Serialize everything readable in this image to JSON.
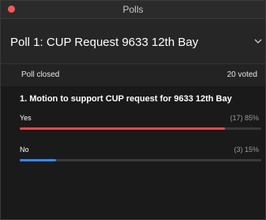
{
  "window": {
    "title": "Polls"
  },
  "poll": {
    "title": "Poll 1: CUP Request 9633 12th Bay",
    "status": "Poll closed",
    "voted": "20 voted",
    "question": "1. Motion to support CUP request for 9633 12th Bay",
    "options": [
      {
        "label": "Yes",
        "result": "(17) 85%",
        "fraction": 0.85,
        "color": "#e8474c"
      },
      {
        "label": "No",
        "result": "(3) 15%",
        "fraction": 0.15,
        "color": "#2d8cff"
      }
    ]
  },
  "icons": {
    "close": "close-dot-icon",
    "expand": "chevron-down-icon"
  }
}
